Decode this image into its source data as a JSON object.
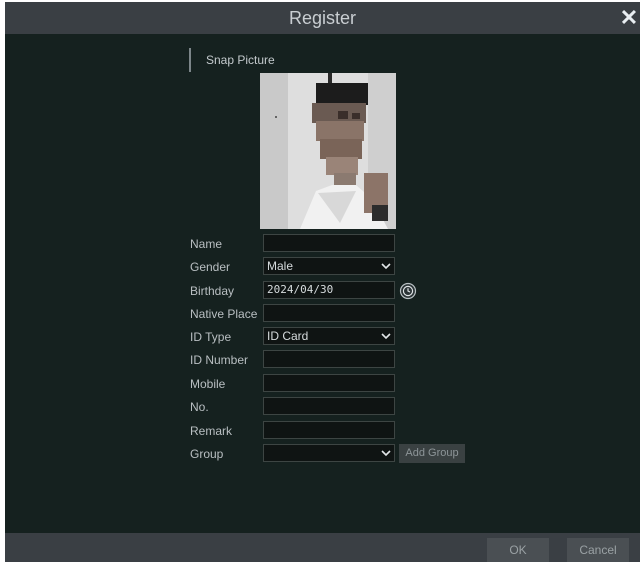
{
  "dialog": {
    "title": "Register",
    "close_symbol": "✕"
  },
  "snap": {
    "section_title": "Snap Picture"
  },
  "form": {
    "name": {
      "label": "Name",
      "value": ""
    },
    "gender": {
      "label": "Gender",
      "value": "Male"
    },
    "birthday": {
      "label": "Birthday",
      "value": "2024/04/30"
    },
    "native_place": {
      "label": "Native Place",
      "value": ""
    },
    "id_type": {
      "label": "ID Type",
      "value": "ID Card"
    },
    "id_number": {
      "label": "ID Number",
      "value": ""
    },
    "mobile": {
      "label": "Mobile",
      "value": ""
    },
    "no": {
      "label": "No.",
      "value": ""
    },
    "remark": {
      "label": "Remark",
      "value": ""
    },
    "group": {
      "label": "Group",
      "value": ""
    },
    "add_group_label": "Add Group"
  },
  "footer": {
    "ok_label": "OK",
    "cancel_label": "Cancel"
  },
  "colors": {
    "dialog_bg": "#15211f",
    "titlebar_bg": "#3a3f44",
    "field_bg": "#0f1413"
  },
  "icons": {
    "close": "close-icon",
    "dropdown": "chevron-down-icon",
    "calendar": "clock-icon"
  }
}
